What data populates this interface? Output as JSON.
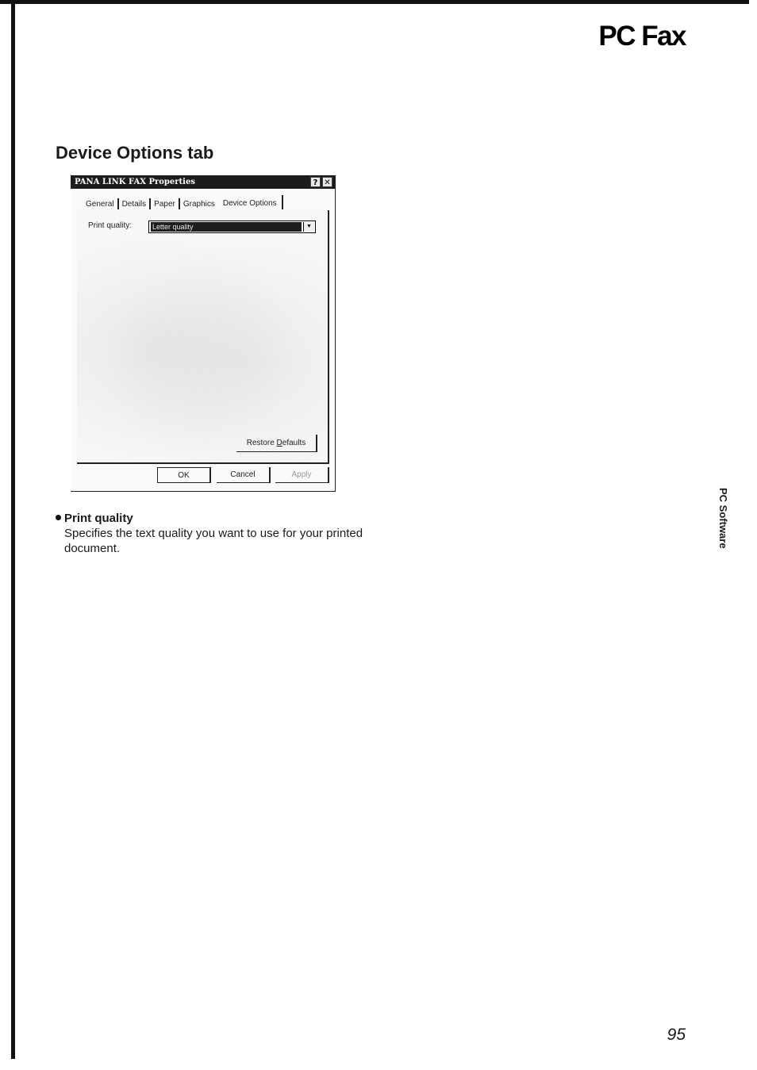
{
  "header": {
    "title": "PC Fax"
  },
  "section": {
    "title": "Device Options tab"
  },
  "dialog": {
    "title": "PANA LINK FAX Properties",
    "help_glyph": "?",
    "close_glyph": "✕",
    "tabs": [
      "General",
      "Details",
      "Paper",
      "Graphics",
      "Device Options"
    ],
    "print_quality_label": "Print quality:",
    "print_quality_value": "Letter quality",
    "restore_button_prefix": "Restore ",
    "restore_button_accel": "D",
    "restore_button_suffix": "efaults",
    "ok_label": "OK",
    "cancel_label": "Cancel",
    "apply_label": "Apply"
  },
  "content": {
    "bullet_title": "Print quality",
    "bullet_body": "Specifies the text quality you want to use for your printed document."
  },
  "sidebar": {
    "label": "PC Software"
  },
  "footer": {
    "page_number": "95"
  }
}
